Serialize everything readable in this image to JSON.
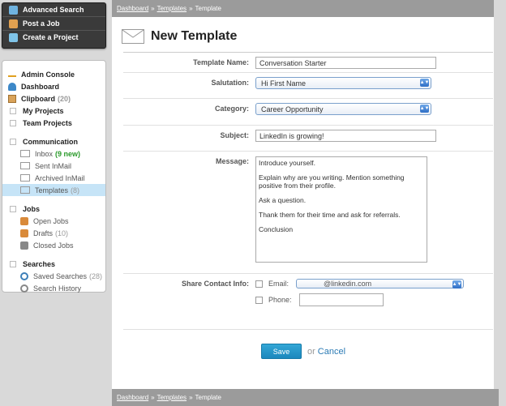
{
  "quick_actions": [
    {
      "label": "Advanced Search",
      "icon": "search-icon"
    },
    {
      "label": "Post a Job",
      "icon": "briefcase-icon"
    },
    {
      "label": "Create a Project",
      "icon": "project-icon"
    }
  ],
  "nav": {
    "admin_console": "Admin Console",
    "dashboard": "Dashboard",
    "clipboard": "Clipboard",
    "clipboard_count": "(20)",
    "my_projects": "My Projects",
    "team_projects": "Team Projects",
    "communication": "Communication",
    "inbox": "Inbox",
    "inbox_new": "(9 new)",
    "sent_inmail": "Sent InMail",
    "archived_inmail": "Archived InMail",
    "templates": "Templates",
    "templates_count": "(8)",
    "jobs": "Jobs",
    "open_jobs": "Open Jobs",
    "drafts": "Drafts",
    "drafts_count": "(10)",
    "closed_jobs": "Closed Jobs",
    "searches": "Searches",
    "saved_searches": "Saved Searches",
    "saved_searches_count": "(28)",
    "search_history": "Search History"
  },
  "breadcrumb": {
    "dashboard": "Dashboard",
    "templates": "Templates",
    "current": "Template",
    "sep": "»"
  },
  "page_title": "New Template",
  "form": {
    "name_label": "Template Name:",
    "name_value": "Conversation Starter",
    "salutation_label": "Salutation:",
    "salutation_value": "Hi First Name",
    "category_label": "Category:",
    "category_value": "Career Opportunity",
    "subject_label": "Subject:",
    "subject_value": "LinkedIn is growing!",
    "message_label": "Message:",
    "message_lines": [
      "Introduce yourself.",
      "Explain why are you writing.  Mention something positive from their profile.",
      "Ask a question.",
      "Thank them for their time and ask for referrals.",
      "Conclusion"
    ],
    "share_label": "Share Contact Info:",
    "email_label": "Email:",
    "email_value": "@linkedin.com",
    "phone_label": "Phone:"
  },
  "actions": {
    "save": "Save",
    "or": "or",
    "cancel": "Cancel"
  },
  "colors": {
    "accent": "#1b87bd",
    "selected_nav": "#c6e4f7",
    "new_badge": "#2a9a2a"
  }
}
